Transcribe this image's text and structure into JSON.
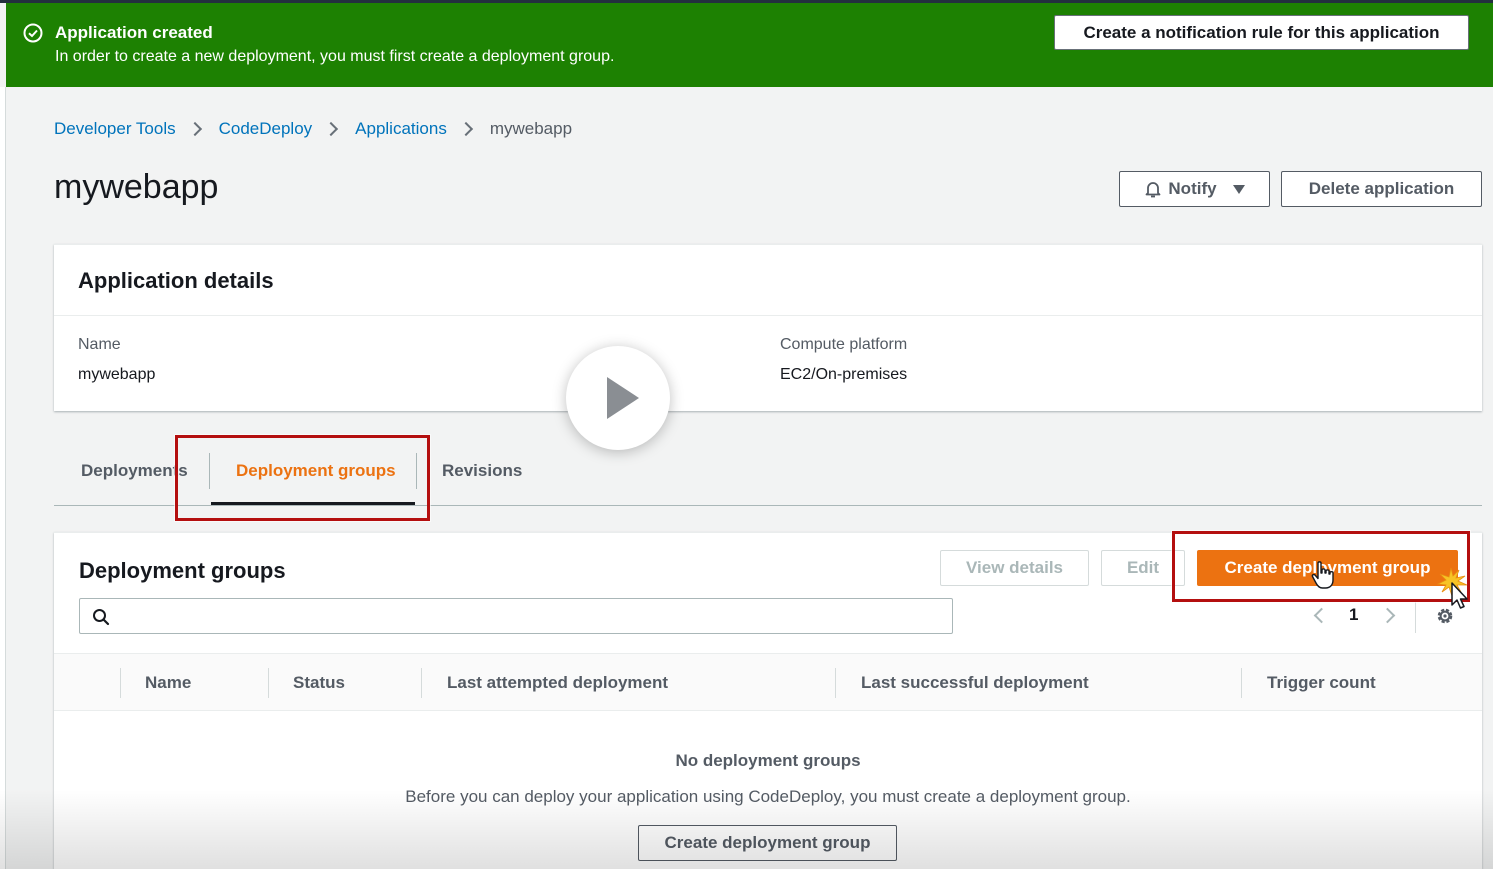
{
  "flash": {
    "title": "Application created",
    "message": "In order to create a new deployment, you must first create a deployment group.",
    "action_label": "Create a notification rule for this application",
    "color": "#1d8102"
  },
  "breadcrumb": {
    "items": [
      "Developer Tools",
      "CodeDeploy",
      "Applications"
    ],
    "current": "mywebapp"
  },
  "page": {
    "title": "mywebapp",
    "notify_label": "Notify",
    "delete_label": "Delete application"
  },
  "details": {
    "title": "Application details",
    "name_label": "Name",
    "name_value": "mywebapp",
    "platform_label": "Compute platform",
    "platform_value": "EC2/On-premises"
  },
  "tabs": [
    {
      "label": "Deployments",
      "active": false
    },
    {
      "label": "Deployment groups",
      "active": true
    },
    {
      "label": "Revisions",
      "active": false
    }
  ],
  "groups": {
    "title": "Deployment groups",
    "view_details_label": "View details",
    "edit_label": "Edit",
    "create_label": "Create deployment group",
    "search_placeholder": "",
    "page_number": "1",
    "columns": [
      "Name",
      "Status",
      "Last attempted deployment",
      "Last successful deployment",
      "Trigger count"
    ],
    "empty_title": "No deployment groups",
    "empty_desc": "Before you can deploy your application using CodeDeploy, you must create a deployment group.",
    "empty_create_label": "Create deployment group"
  },
  "colors": {
    "accent": "#ec7211",
    "link": "#0073bb",
    "highlight": "#b40f0f"
  }
}
